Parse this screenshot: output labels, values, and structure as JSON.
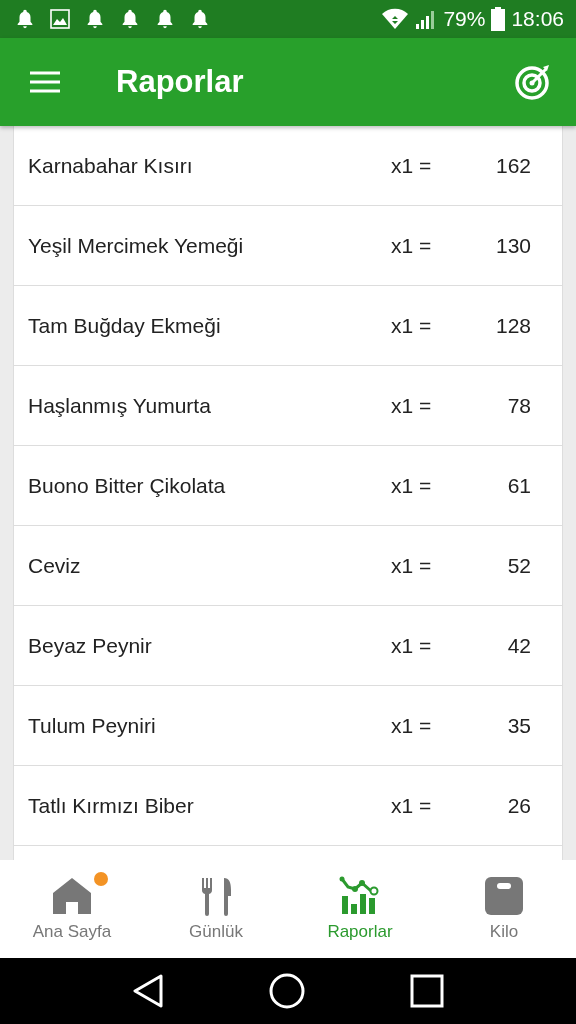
{
  "status_bar": {
    "battery": "79%",
    "time": "18:06"
  },
  "app_bar": {
    "title": "Raporlar"
  },
  "report_rows": [
    {
      "name": "Karnabahar Kısırı",
      "multiplier": "x1 =",
      "value": "162"
    },
    {
      "name": "Yeşil Mercimek Yemeği",
      "multiplier": "x1 =",
      "value": "130"
    },
    {
      "name": "Tam Buğday Ekmeği",
      "multiplier": "x1 =",
      "value": "128"
    },
    {
      "name": "Haşlanmış Yumurta",
      "multiplier": "x1 =",
      "value": "78"
    },
    {
      "name": "Buono Bitter Çikolata",
      "multiplier": "x1 =",
      "value": "61"
    },
    {
      "name": "Ceviz",
      "multiplier": "x1 =",
      "value": "52"
    },
    {
      "name": "Beyaz Peynir",
      "multiplier": "x1 =",
      "value": "42"
    },
    {
      "name": "Tulum Peyniri",
      "multiplier": "x1 =",
      "value": "35"
    },
    {
      "name": "Tatlı Kırmızı Biber",
      "multiplier": "x1 =",
      "value": "26"
    }
  ],
  "bottom_nav": [
    {
      "label": "Ana Sayfa",
      "kind": "home",
      "selected": false,
      "badge": true
    },
    {
      "label": "Günlük",
      "kind": "diary",
      "selected": false,
      "badge": false
    },
    {
      "label": "Raporlar",
      "kind": "reports",
      "selected": true,
      "badge": false
    },
    {
      "label": "Kilo",
      "kind": "weight",
      "selected": false,
      "badge": false
    }
  ]
}
